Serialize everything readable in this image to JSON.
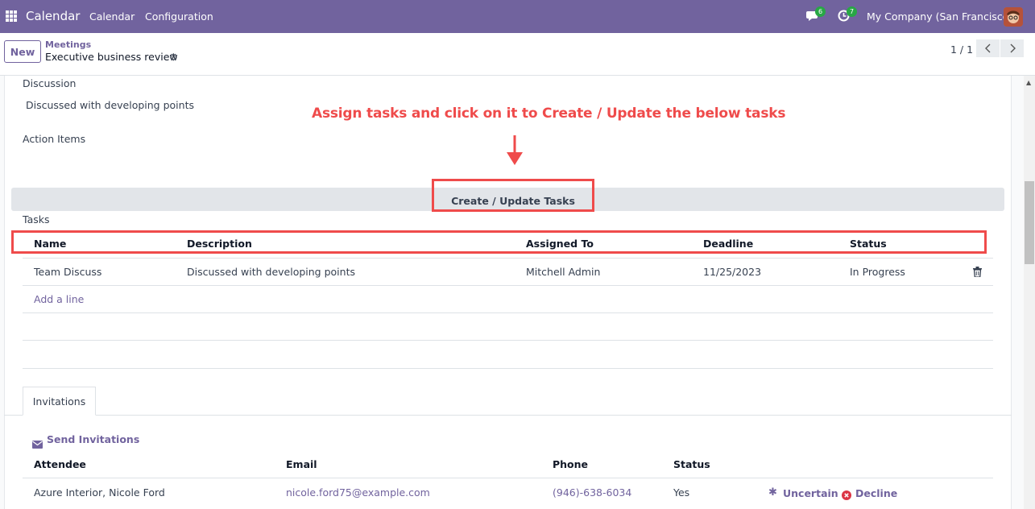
{
  "topbar": {
    "app_name": "Calendar",
    "menus": [
      "Calendar",
      "Configuration"
    ],
    "messages_count": "6",
    "activities_count": "7",
    "company": "My Company (San Francisco)"
  },
  "control": {
    "new_label": "New",
    "breadcrumb_parent": "Meetings",
    "breadcrumb_current": "Executive business review",
    "pager_value": "1 / 1"
  },
  "form": {
    "discussion_label": "Discussion",
    "discussion_value": "Discussed with developing points",
    "action_items_label": "Action Items",
    "annotation": "Assign tasks and click on it to Create / Update the below tasks",
    "create_update_label": "Create / Update Tasks",
    "tasks_label": "Tasks"
  },
  "tasks": {
    "columns": [
      "Name",
      "Description",
      "Assigned To",
      "Deadline",
      "Status"
    ],
    "rows": [
      {
        "name": "Team Discuss",
        "description": "Discussed with developing points",
        "assigned_to": "Mitchell Admin",
        "deadline": "11/25/2023",
        "status": "In Progress"
      }
    ],
    "add_line": "Add a line"
  },
  "invitations": {
    "tab_label": "Invitations",
    "send_label": "Send Invitations",
    "columns": [
      "Attendee",
      "Email",
      "Phone",
      "Status"
    ],
    "rows": [
      {
        "attendee": "Azure Interior, Nicole Ford",
        "email": "nicole.ford75@example.com",
        "phone": "(946)-638-6034",
        "status": "Yes",
        "uncertain": "Uncertain",
        "decline": "Decline"
      }
    ]
  },
  "colors": {
    "brand": "#71639e",
    "annotation_red": "#ef4b4b",
    "badge_green": "#28a745"
  }
}
